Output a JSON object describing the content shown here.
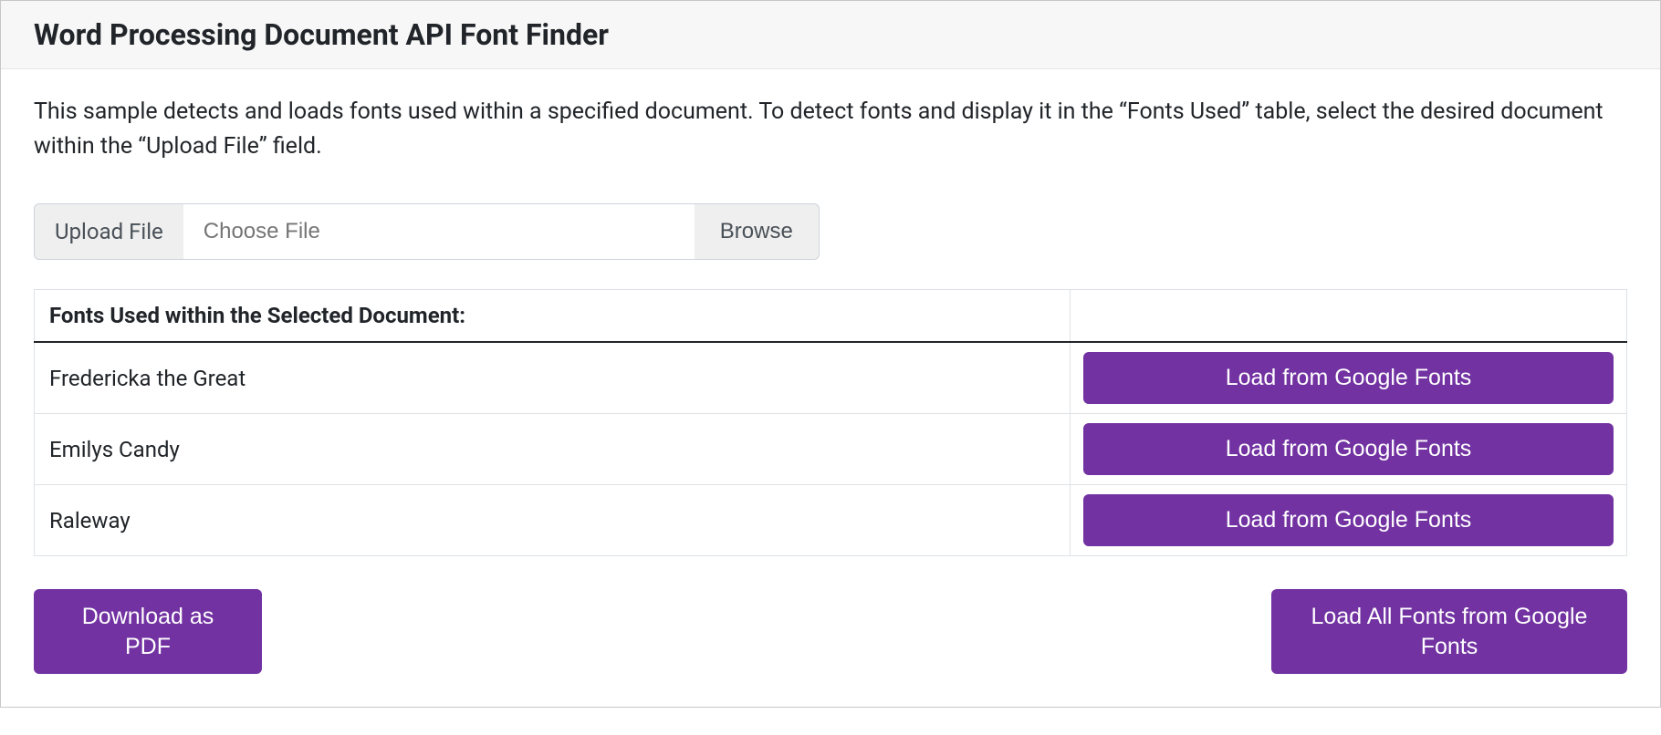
{
  "header": {
    "title": "Word Processing Document API Font Finder"
  },
  "description": "This sample detects and loads fonts used within a specified document. To detect fonts and display it in the “Fonts Used” table, select the desired document within the “Upload File” field.",
  "upload": {
    "label": "Upload File",
    "placeholder": "Choose File",
    "browse_label": "Browse"
  },
  "table": {
    "header": "Fonts Used within the Selected Document:",
    "load_button_label": "Load from Google Fonts",
    "fonts": [
      {
        "name": "Fredericka the Great"
      },
      {
        "name": "Emilys Candy"
      },
      {
        "name": "Raleway"
      }
    ]
  },
  "footer": {
    "download_label": "Download as PDF",
    "load_all_label": "Load All Fonts from Google Fonts"
  },
  "colors": {
    "accent": "#7232a2"
  }
}
